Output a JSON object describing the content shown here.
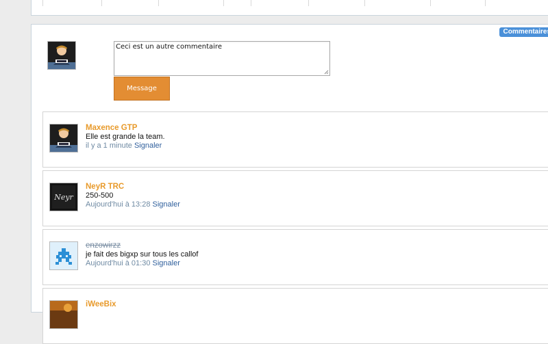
{
  "header_tab": "Commentaires",
  "composer": {
    "textarea_value": "Ceci est un autre commentaire",
    "button_label": "Message"
  },
  "comments": [
    {
      "author": "Maxence GTP",
      "text": "Elle est grande la team.",
      "time": "il y a 1 minute",
      "report": "Signaler",
      "author_struck": false
    },
    {
      "author": "NeyR TRC",
      "text": "250-500",
      "time": "Aujourd'hui à 13:28",
      "report": "Signaler",
      "author_struck": false
    },
    {
      "author": "enzowirzz",
      "text": "je fait des bigxp sur tous les callof",
      "time": "Aujourd'hui à 01:30",
      "report": "Signaler",
      "author_struck": true
    },
    {
      "author": "iWeeBix",
      "text": "",
      "time": "",
      "report": "",
      "author_struck": false
    }
  ],
  "colors": {
    "author": "#e89a2b",
    "button": "#e38d33",
    "meta": "#6f8aa3",
    "link": "#2f5f9c",
    "tab": "#4a90d9"
  }
}
